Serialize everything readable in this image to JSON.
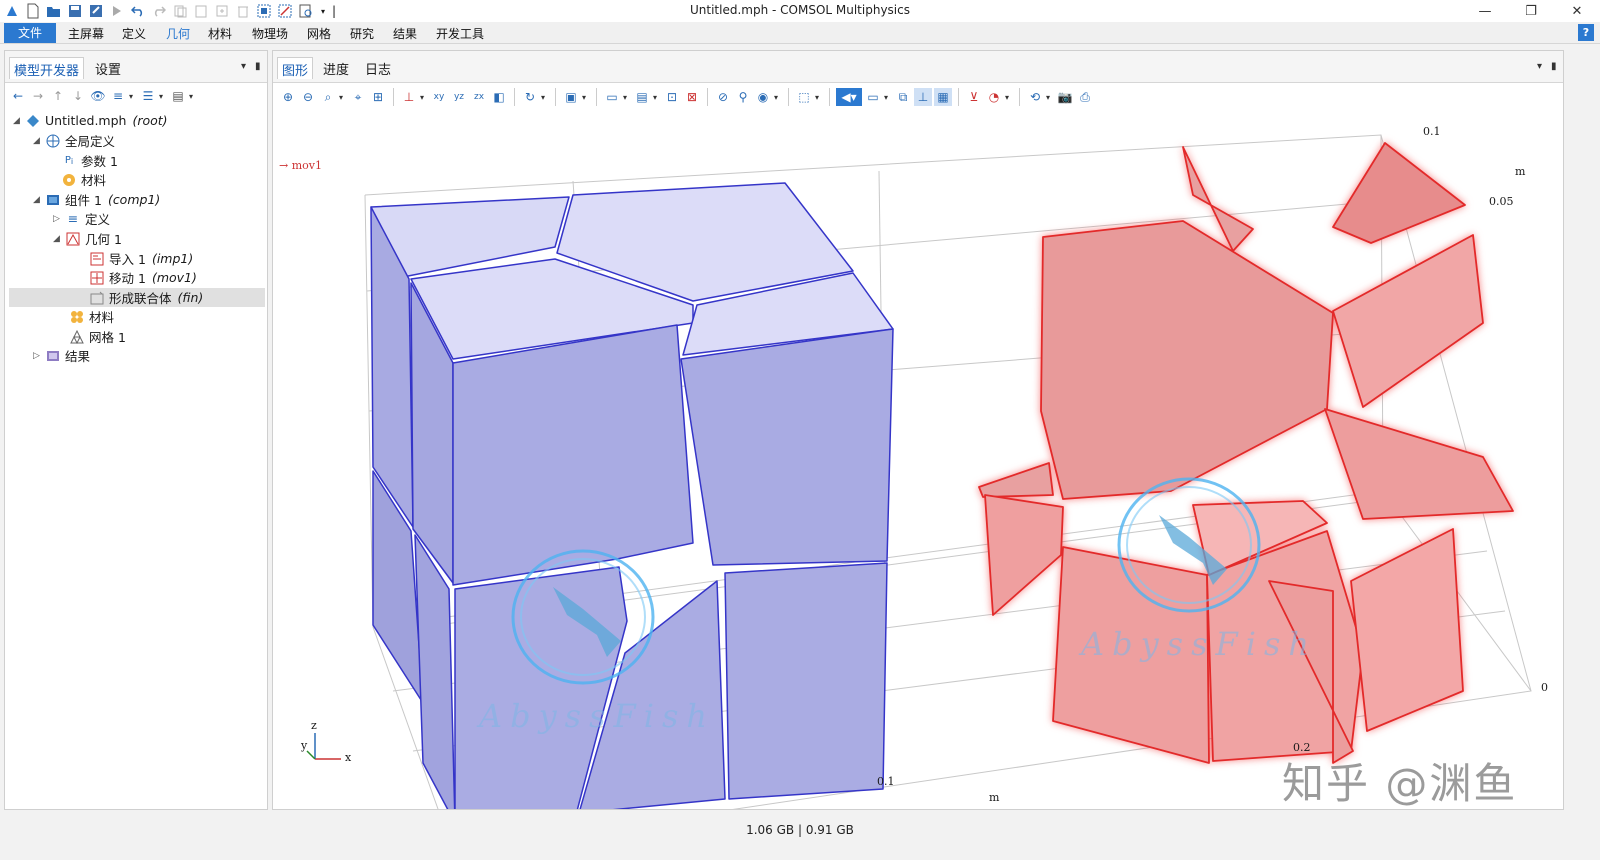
{
  "window": {
    "title": "Untitled.mph - COMSOL Multiphysics",
    "minimize": "—",
    "maximize": "❐",
    "close": "✕"
  },
  "menu": {
    "file": "文件",
    "items": [
      "主屏幕",
      "定义",
      "几何",
      "材料",
      "物理场",
      "网格",
      "研究",
      "结果",
      "开发工具"
    ],
    "active": "几何",
    "help": "?"
  },
  "left_pane": {
    "tabs": [
      "模型开发器",
      "设置"
    ],
    "tree": [
      {
        "label": "Untitled.mph",
        "tag": "(root)",
        "level": 0,
        "expanded": true,
        "icon": "model-icon"
      },
      {
        "label": "全局定义",
        "tag": "",
        "level": 1,
        "expanded": true,
        "icon": "globe-icon"
      },
      {
        "label": "参数 1",
        "tag": "",
        "level": 2,
        "icon": "parameter-icon"
      },
      {
        "label": "材料",
        "tag": "",
        "level": 2,
        "icon": "material-icon"
      },
      {
        "label": "组件 1",
        "tag": "(comp1)",
        "level": 1,
        "expanded": true,
        "icon": "component-icon"
      },
      {
        "label": "定义",
        "tag": "",
        "level": 2,
        "collapsed": true,
        "icon": "definitions-icon"
      },
      {
        "label": "几何 1",
        "tag": "",
        "level": 2,
        "expanded": true,
        "icon": "geometry-icon"
      },
      {
        "label": "导入 1",
        "tag": "(imp1)",
        "level": 3,
        "icon": "import-icon"
      },
      {
        "label": "移动 1",
        "tag": "(mov1)",
        "level": 3,
        "icon": "move-icon"
      },
      {
        "label": "形成联合体",
        "tag": "(fin)",
        "level": 3,
        "icon": "form-union-icon",
        "selected": true
      },
      {
        "label": "材料",
        "tag": "",
        "level": 2,
        "icon": "material-icon"
      },
      {
        "label": "网格 1",
        "tag": "",
        "level": 2,
        "icon": "mesh-icon"
      },
      {
        "label": "结果",
        "tag": "",
        "level": 1,
        "collapsed": true,
        "icon": "results-icon"
      }
    ]
  },
  "graphics_pane": {
    "tabs": [
      "图形",
      "进度",
      "日志"
    ],
    "move_label": "mov1",
    "axis_ticks": {
      "top_right": "0.1",
      "top_m": "m",
      "right_005": "0.05",
      "right_zero": "0",
      "bottom_02": "0.2",
      "bottom_01": "0.1",
      "bottom_m": "m"
    },
    "triad": {
      "x": "x",
      "y": "y",
      "z": "z"
    },
    "watermark": "AbyssFish"
  },
  "status": {
    "memory": "1.06 GB | 0.91 GB"
  },
  "overlay": {
    "zhihu": "知乎 @渊鱼"
  },
  "colors": {
    "accent": "#2b79d0",
    "solid_blue_fill": "#a7a8e0",
    "solid_blue_edge": "#3535c8",
    "solid_red_fill": "#ee9f9f",
    "solid_red_edge": "#e32a2a"
  }
}
